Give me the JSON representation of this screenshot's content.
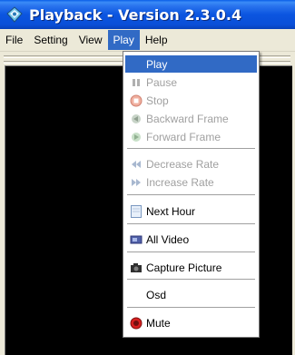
{
  "window": {
    "title": "Playback - Version 2.3.0.4"
  },
  "menubar": {
    "items": [
      "File",
      "Setting",
      "View",
      "Play",
      "Help"
    ],
    "active": "Play"
  },
  "play_menu": {
    "items": [
      {
        "label": "Play",
        "icon": "none",
        "enabled": true,
        "highlighted": true
      },
      {
        "label": "Pause",
        "icon": "pause-icon",
        "enabled": false
      },
      {
        "label": "Stop",
        "icon": "stop-icon",
        "enabled": false
      },
      {
        "label": "Backward Frame",
        "icon": "backward-frame-icon",
        "enabled": false
      },
      {
        "label": "Forward  Frame",
        "icon": "forward-frame-icon",
        "enabled": false
      },
      {
        "label": "Decrease Rate",
        "icon": "decrease-rate-icon",
        "enabled": false
      },
      {
        "label": "Increase Rate",
        "icon": "increase-rate-icon",
        "enabled": false
      },
      {
        "label": "Next Hour",
        "icon": "document-icon",
        "enabled": true
      },
      {
        "label": "All Video",
        "icon": "video-icon",
        "enabled": true
      },
      {
        "label": "Capture Picture",
        "icon": "camera-icon",
        "enabled": true
      },
      {
        "label": "Osd",
        "icon": "none",
        "enabled": true
      },
      {
        "label": "Mute",
        "icon": "mute-icon",
        "enabled": true
      }
    ]
  },
  "colors": {
    "highlight": "#316ac5",
    "titlebar": "#0a55e0",
    "menubar": "#ece9d8",
    "video": "#000000"
  }
}
